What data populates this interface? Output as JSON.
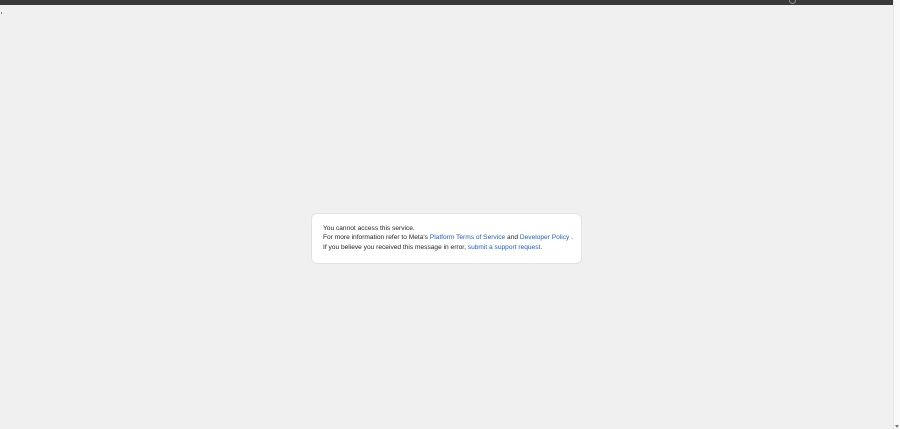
{
  "notice": {
    "line1": "You cannot access this service.",
    "line2_prefix": "For more information refer to Meta's ",
    "terms_link": "Platform Terms of Service",
    "line2_and": " and ",
    "policy_link": "Developer Policy",
    "line2_suffix": " .",
    "line3_prefix": "If you believe you received this message in error, ",
    "support_link": "submit a support request",
    "line3_suffix": "."
  },
  "colors": {
    "background": "#f0f0f0",
    "topbar": "#3a3a3a",
    "link": "#1d5fc2",
    "text": "#1c1e21"
  }
}
